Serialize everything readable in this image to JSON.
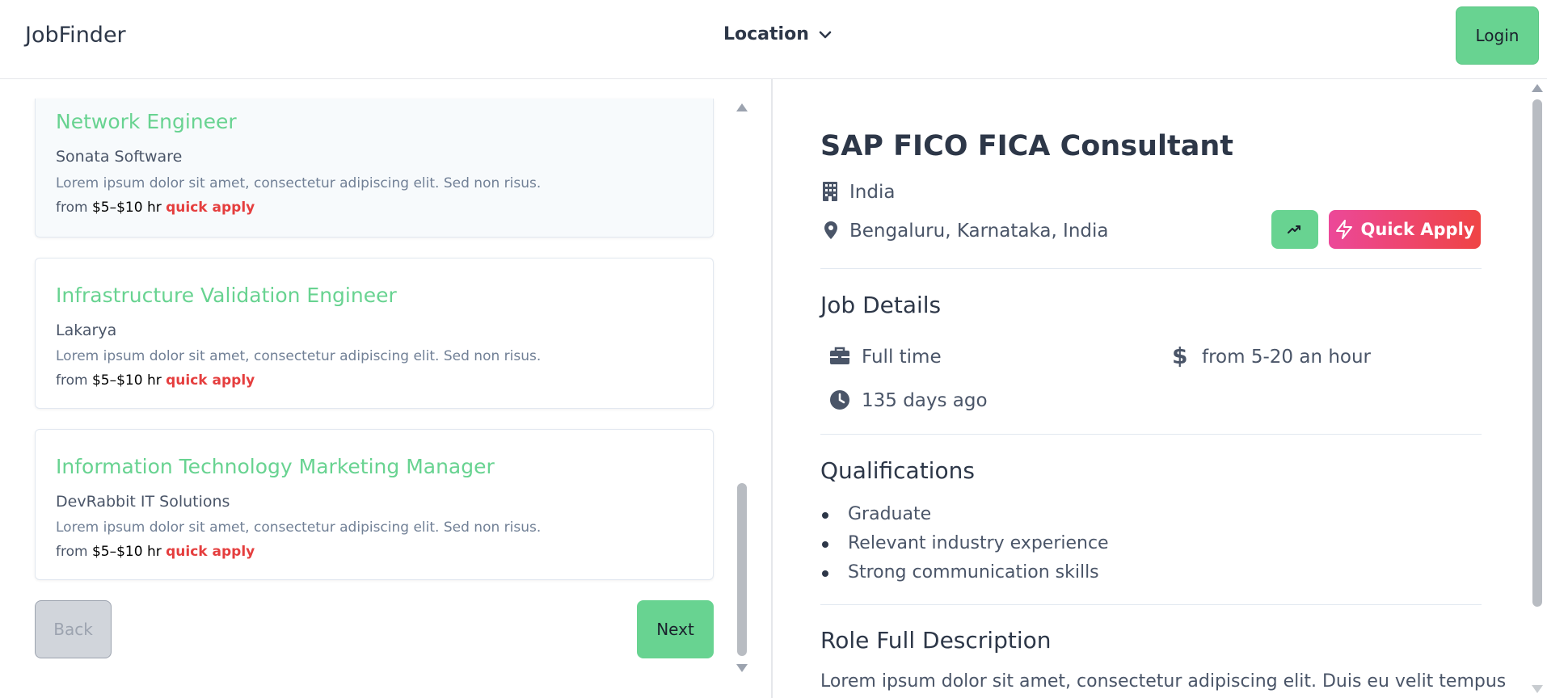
{
  "header": {
    "brand": "JobFinder",
    "location_label": "Location",
    "login_label": "Login"
  },
  "job_list": [
    {
      "title": "Network Engineer",
      "company": "Sonata Software",
      "description": "Lorem ipsum dolor sit amet, consectetur adipiscing elit. Sed non risus.",
      "from_label": "from",
      "salary": "$5–$10 hr",
      "quick_apply": "quick apply"
    },
    {
      "title": "Infrastructure Validation Engineer",
      "company": "Lakarya",
      "description": "Lorem ipsum dolor sit amet, consectetur adipiscing elit. Sed non risus.",
      "from_label": "from",
      "salary": "$5–$10 hr",
      "quick_apply": "quick apply"
    },
    {
      "title": "Information Technology Marketing Manager",
      "company": "DevRabbit IT Solutions",
      "description": "Lorem ipsum dolor sit amet, consectetur adipiscing elit. Sed non risus.",
      "from_label": "from",
      "salary": "$5–$10 hr",
      "quick_apply": "quick apply"
    }
  ],
  "pagination": {
    "back_label": "Back",
    "next_label": "Next"
  },
  "detail": {
    "title": "SAP FICO FICA Consultant",
    "company": "India",
    "location": "Bengaluru, Karnataka, India",
    "quick_apply_label": "Quick Apply",
    "job_details_heading": "Job Details",
    "job_type": "Full time",
    "pay": "from 5-20 an hour",
    "posted": "135 days ago",
    "qualifications_heading": "Qualifications",
    "qualifications": [
      "Graduate",
      "Relevant industry experience",
      "Strong communication skills"
    ],
    "description_heading": "Role Full Description",
    "description": "Lorem ipsum dolor sit amet, consectetur adipiscing elit. Duis eu velit tempus"
  },
  "colors": {
    "accent_green": "#68d391",
    "quick_apply_red": "#e53e3e",
    "gradient_start": "#ec4899",
    "gradient_end": "#ef4444"
  },
  "icons": {
    "location_dropdown": "chevron-down-icon",
    "company": "building-icon",
    "location": "map-pin-icon",
    "trend": "trending-up-icon",
    "quick_apply": "lightning-icon",
    "job_type": "briefcase-icon",
    "pay": "dollar-icon",
    "posted": "clock-icon"
  }
}
